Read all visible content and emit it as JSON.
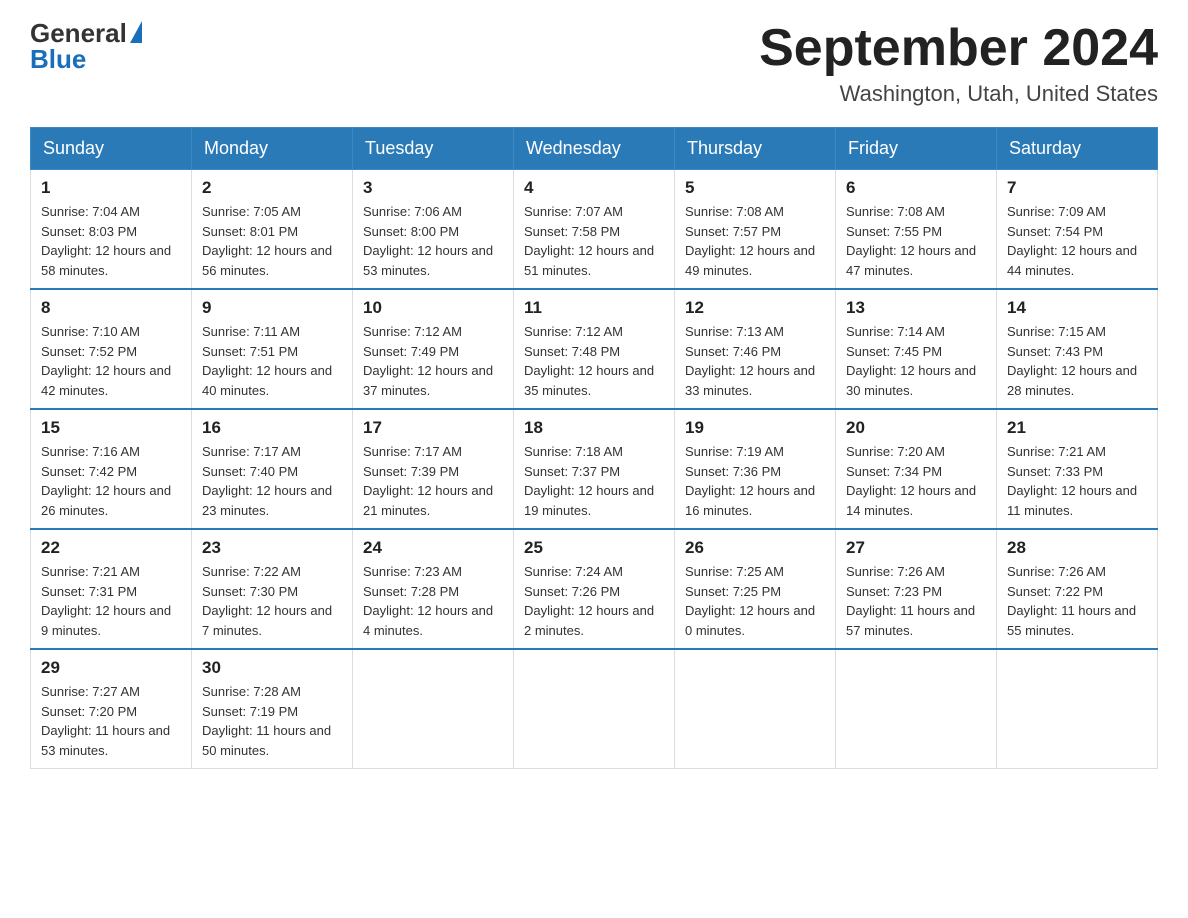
{
  "header": {
    "logo_general": "General",
    "logo_blue": "Blue",
    "month_title": "September 2024",
    "location": "Washington, Utah, United States"
  },
  "weekdays": [
    "Sunday",
    "Monday",
    "Tuesday",
    "Wednesday",
    "Thursday",
    "Friday",
    "Saturday"
  ],
  "weeks": [
    [
      {
        "day": "1",
        "sunrise": "7:04 AM",
        "sunset": "8:03 PM",
        "daylight": "12 hours and 58 minutes."
      },
      {
        "day": "2",
        "sunrise": "7:05 AM",
        "sunset": "8:01 PM",
        "daylight": "12 hours and 56 minutes."
      },
      {
        "day": "3",
        "sunrise": "7:06 AM",
        "sunset": "8:00 PM",
        "daylight": "12 hours and 53 minutes."
      },
      {
        "day": "4",
        "sunrise": "7:07 AM",
        "sunset": "7:58 PM",
        "daylight": "12 hours and 51 minutes."
      },
      {
        "day": "5",
        "sunrise": "7:08 AM",
        "sunset": "7:57 PM",
        "daylight": "12 hours and 49 minutes."
      },
      {
        "day": "6",
        "sunrise": "7:08 AM",
        "sunset": "7:55 PM",
        "daylight": "12 hours and 47 minutes."
      },
      {
        "day": "7",
        "sunrise": "7:09 AM",
        "sunset": "7:54 PM",
        "daylight": "12 hours and 44 minutes."
      }
    ],
    [
      {
        "day": "8",
        "sunrise": "7:10 AM",
        "sunset": "7:52 PM",
        "daylight": "12 hours and 42 minutes."
      },
      {
        "day": "9",
        "sunrise": "7:11 AM",
        "sunset": "7:51 PM",
        "daylight": "12 hours and 40 minutes."
      },
      {
        "day": "10",
        "sunrise": "7:12 AM",
        "sunset": "7:49 PM",
        "daylight": "12 hours and 37 minutes."
      },
      {
        "day": "11",
        "sunrise": "7:12 AM",
        "sunset": "7:48 PM",
        "daylight": "12 hours and 35 minutes."
      },
      {
        "day": "12",
        "sunrise": "7:13 AM",
        "sunset": "7:46 PM",
        "daylight": "12 hours and 33 minutes."
      },
      {
        "day": "13",
        "sunrise": "7:14 AM",
        "sunset": "7:45 PM",
        "daylight": "12 hours and 30 minutes."
      },
      {
        "day": "14",
        "sunrise": "7:15 AM",
        "sunset": "7:43 PM",
        "daylight": "12 hours and 28 minutes."
      }
    ],
    [
      {
        "day": "15",
        "sunrise": "7:16 AM",
        "sunset": "7:42 PM",
        "daylight": "12 hours and 26 minutes."
      },
      {
        "day": "16",
        "sunrise": "7:17 AM",
        "sunset": "7:40 PM",
        "daylight": "12 hours and 23 minutes."
      },
      {
        "day": "17",
        "sunrise": "7:17 AM",
        "sunset": "7:39 PM",
        "daylight": "12 hours and 21 minutes."
      },
      {
        "day": "18",
        "sunrise": "7:18 AM",
        "sunset": "7:37 PM",
        "daylight": "12 hours and 19 minutes."
      },
      {
        "day": "19",
        "sunrise": "7:19 AM",
        "sunset": "7:36 PM",
        "daylight": "12 hours and 16 minutes."
      },
      {
        "day": "20",
        "sunrise": "7:20 AM",
        "sunset": "7:34 PM",
        "daylight": "12 hours and 14 minutes."
      },
      {
        "day": "21",
        "sunrise": "7:21 AM",
        "sunset": "7:33 PM",
        "daylight": "12 hours and 11 minutes."
      }
    ],
    [
      {
        "day": "22",
        "sunrise": "7:21 AM",
        "sunset": "7:31 PM",
        "daylight": "12 hours and 9 minutes."
      },
      {
        "day": "23",
        "sunrise": "7:22 AM",
        "sunset": "7:30 PM",
        "daylight": "12 hours and 7 minutes."
      },
      {
        "day": "24",
        "sunrise": "7:23 AM",
        "sunset": "7:28 PM",
        "daylight": "12 hours and 4 minutes."
      },
      {
        "day": "25",
        "sunrise": "7:24 AM",
        "sunset": "7:26 PM",
        "daylight": "12 hours and 2 minutes."
      },
      {
        "day": "26",
        "sunrise": "7:25 AM",
        "sunset": "7:25 PM",
        "daylight": "12 hours and 0 minutes."
      },
      {
        "day": "27",
        "sunrise": "7:26 AM",
        "sunset": "7:23 PM",
        "daylight": "11 hours and 57 minutes."
      },
      {
        "day": "28",
        "sunrise": "7:26 AM",
        "sunset": "7:22 PM",
        "daylight": "11 hours and 55 minutes."
      }
    ],
    [
      {
        "day": "29",
        "sunrise": "7:27 AM",
        "sunset": "7:20 PM",
        "daylight": "11 hours and 53 minutes."
      },
      {
        "day": "30",
        "sunrise": "7:28 AM",
        "sunset": "7:19 PM",
        "daylight": "11 hours and 50 minutes."
      },
      null,
      null,
      null,
      null,
      null
    ]
  ],
  "labels": {
    "sunrise": "Sunrise:",
    "sunset": "Sunset:",
    "daylight": "Daylight:"
  }
}
